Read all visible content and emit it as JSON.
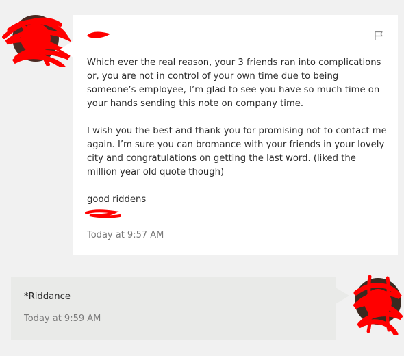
{
  "incoming": {
    "paragraphs": [
      "Which ever the real reason, your 3 friends ran into complications or, you are not in control of your own time due to being someone’s employee, I’m glad to see you have so much time on your hands sending this note on company time.",
      "I wish you the best and thank you for promising not to contact me again. I’m sure you can bromance with your friends in your lovely city and congratulations on getting the last word. (liked the million year old quote though)",
      "good riddens"
    ],
    "timestamp": "Today at 9:57 AM",
    "flag_icon": "flag-icon"
  },
  "outgoing": {
    "text": "*Riddance",
    "timestamp": "Today at 9:59 AM"
  },
  "colors": {
    "background": "#f1f1f1",
    "incoming_bubble": "#ffffff",
    "outgoing_bubble": "#e9eae8",
    "redaction": "#ff0000",
    "text": "#2c2c2c",
    "timestamp": "#7a7a7a"
  }
}
